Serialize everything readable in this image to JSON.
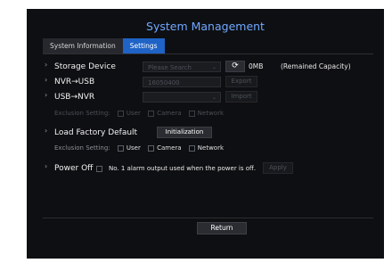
{
  "window": {
    "title": "System Management"
  },
  "tabs": [
    {
      "label": "System Information",
      "active": false
    },
    {
      "label": "Settings",
      "active": true
    }
  ],
  "storage": {
    "label": "Storage Device",
    "select_value": "Please Search",
    "refresh_icon": "refresh-icon",
    "size": "0MB",
    "note": "(Remained Capacity)"
  },
  "nvr_usb": {
    "label": "NVR→USB",
    "value": "16050400",
    "button": "Export"
  },
  "usb_nvr": {
    "label": "USB→NVR",
    "select_value": "",
    "button": "Import"
  },
  "exclusion_1": {
    "label": "Exclusion Setting:",
    "options": [
      "User",
      "Camera",
      "Network"
    ]
  },
  "factory": {
    "label": "Load Factory Default",
    "button": "Initialization"
  },
  "exclusion_2": {
    "label": "Exclusion Setting:",
    "options": [
      "User",
      "Camera",
      "Network"
    ]
  },
  "power": {
    "label": "Power Off",
    "option_text": "No. 1 alarm output used when the power is off.",
    "button": "Apply"
  },
  "footer": {
    "return_label": "Return"
  },
  "colors": {
    "accent": "#1f63c6",
    "title": "#6fa8ff",
    "background": "#0e0f12"
  }
}
